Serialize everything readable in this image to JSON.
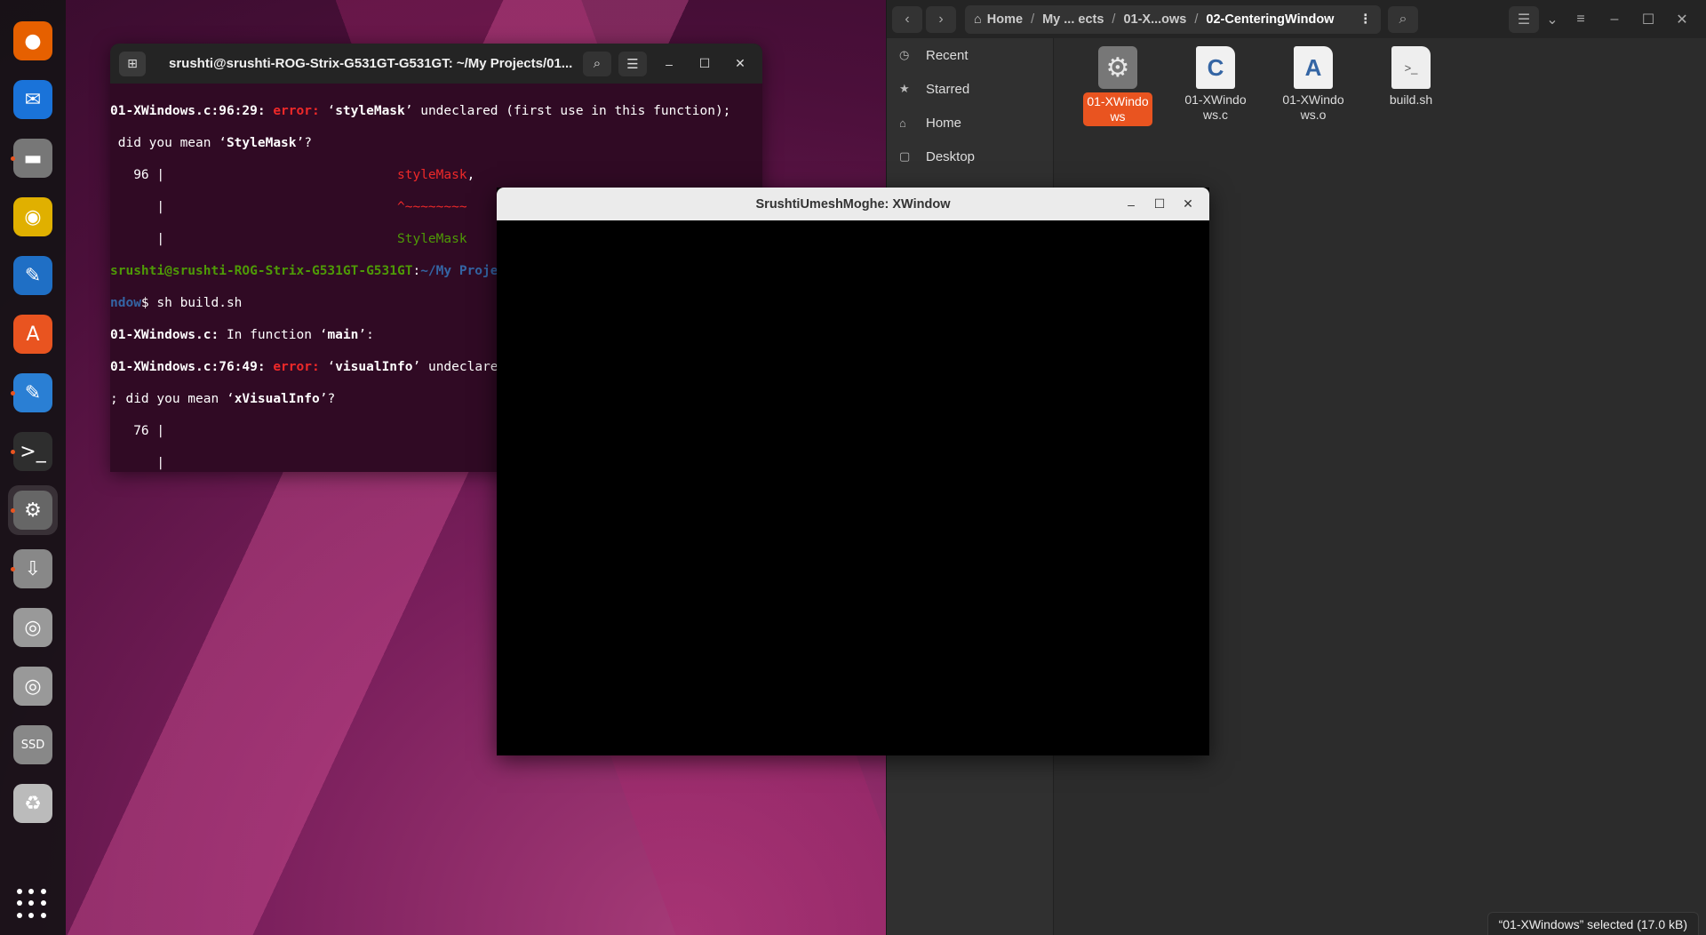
{
  "dock": {
    "items": [
      {
        "name": "firefox-icon",
        "glyph": "●",
        "color": "#e66000",
        "running": false
      },
      {
        "name": "thunderbird-icon",
        "glyph": "✉",
        "color": "#1a73d9",
        "running": false
      },
      {
        "name": "files-icon",
        "glyph": "▬",
        "color": "#777777",
        "running": true
      },
      {
        "name": "rhythmbox-icon",
        "glyph": "◉",
        "color": "#e0b000",
        "running": false
      },
      {
        "name": "writer-icon",
        "glyph": "✎",
        "color": "#1f6fc5",
        "running": false
      },
      {
        "name": "software-icon",
        "glyph": "A",
        "color": "#e95420",
        "running": false
      },
      {
        "name": "text-editor-icon",
        "glyph": "✎",
        "color": "#2a7fd4",
        "running": true
      },
      {
        "name": "terminal-icon",
        "glyph": ">_",
        "color": "#2e2e2e",
        "running": true
      },
      {
        "name": "settings-icon",
        "glyph": "⚙",
        "color": "#666666",
        "running": true,
        "active": true
      },
      {
        "name": "usb-icon",
        "glyph": "⇩",
        "color": "#888888",
        "running": true
      },
      {
        "name": "disc-icon",
        "glyph": "◎",
        "color": "#999999",
        "running": false
      },
      {
        "name": "disc-icon-2",
        "glyph": "◎",
        "color": "#999999",
        "running": false
      },
      {
        "name": "ssd-icon",
        "glyph": "SSD",
        "color": "#888888",
        "running": false
      },
      {
        "name": "trash-icon",
        "glyph": "♻",
        "color": "#bbbbbb",
        "running": false
      }
    ]
  },
  "terminal": {
    "title": "srushti@srushti-ROG-Strix-G531GT-G531GT: ~/My Projects/01..."
  },
  "xwindow": {
    "title": "SrushtiUmeshMoghe: XWindow"
  },
  "files": {
    "path": {
      "home": "Home",
      "seg1": "My ... ects",
      "seg2": "01-X...ows",
      "current": "02-CenteringWindow",
      "sep": "/"
    },
    "sidebar": [
      {
        "label": "Recent",
        "icon": "◷"
      },
      {
        "label": "Starred",
        "icon": "★"
      },
      {
        "label": "Home",
        "icon": "⌂"
      },
      {
        "label": "Desktop",
        "icon": "▢"
      }
    ],
    "items": [
      {
        "label": "01-XWindows",
        "type": "exec",
        "selected": true
      },
      {
        "label": "01-XWindows.c",
        "type": "c"
      },
      {
        "label": "01-XWindows.o",
        "type": "o"
      },
      {
        "label": "build.sh",
        "type": "sh"
      }
    ],
    "status": "“01-XWindows” selected  (17.0 kB)"
  }
}
